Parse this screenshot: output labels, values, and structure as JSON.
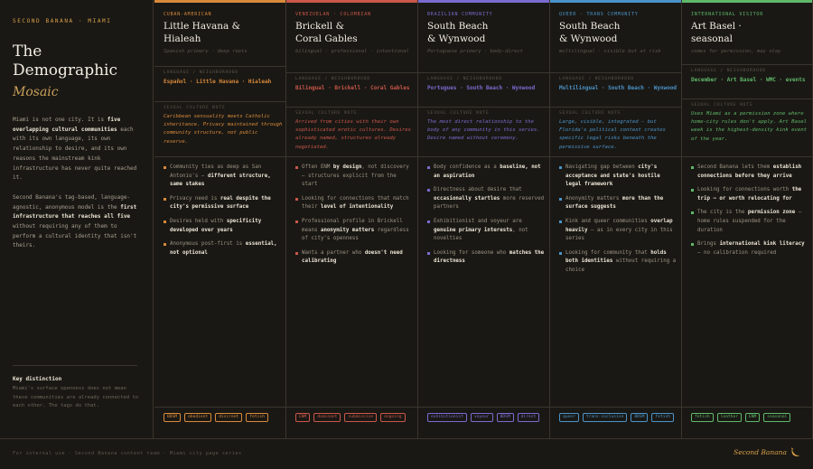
{
  "brand": "SECOND BANANA · MIAMI",
  "hero": {
    "line1": "The",
    "line2": "Demographic",
    "line3": "Mosaic"
  },
  "intro": {
    "p1_a": "Miami is not one city. It is ",
    "p1_b": "five overlapping cultural communities",
    "p1_c": " each with its own language, its own relationship to desire, and its own reasons the mainstream kink infrastructure has never quite reached it.",
    "p2_a": "Second Banana's tag-based, language-agnostic, anonymous model is the ",
    "p2_b": "first infrastructure that reaches all five",
    "p2_c": " without requiring any of them to perform a cultural identity that isn't theirs."
  },
  "key_distinction": {
    "title": "Key distinction",
    "body": "Miami's surface openness does not mean these communities are already connected to each other. The tags do that."
  },
  "labels": {
    "lang": "LANGUAGE / NEIGHBORHOOD",
    "ctx": "SEXUAL CULTURE NOTE"
  },
  "columns": [
    {
      "tag": "CUBAN-AMERICAN",
      "title_1": "Little Havana &",
      "title_2": "Hialeah",
      "sub": "Spanish primary · deep roots",
      "lang": "Español · Little Havana · Hialeah",
      "ctx": "Caribbean sensuality meets Catholic inheritance. Privacy maintained through community structure, not public reserve.",
      "bullets": [
        {
          "a": "Community ties as deep as San Antonio's — ",
          "b": "different structure, same stakes",
          "c": ""
        },
        {
          "a": "Privacy need is ",
          "b": "real despite the city's permissive surface",
          "c": ""
        },
        {
          "a": "Desires held with ",
          "b": "specificity developed over years",
          "c": ""
        },
        {
          "a": "Anonymous post-first is ",
          "b": "essential, not optional",
          "c": ""
        }
      ],
      "tags": [
        "BDSM",
        "obedient",
        "discreet",
        "fetish"
      ]
    },
    {
      "tag": "VENEZUELAN · COLOMBIAN",
      "title_1": "Brickell &",
      "title_2": "Coral Gables",
      "sub": "bilingual · professional · intentional",
      "lang": "Bilingual · Brickell · Coral Gables",
      "ctx": "Arrived from cities with their own sophisticated erotic cultures. Desires already named, structures already negotiated.",
      "bullets": [
        {
          "a": "Often ENM ",
          "b": "by design",
          "c": ", not discovery — structures explicit from the start"
        },
        {
          "a": "Looking for connections that match their ",
          "b": "level of intentionality",
          "c": ""
        },
        {
          "a": "Professional profile in Brickell means ",
          "b": "anonymity matters",
          "c": " regardless of city's openness"
        },
        {
          "a": "Wants a partner who ",
          "b": "doesn't need calibrating",
          "c": ""
        }
      ],
      "tags": [
        "ENM",
        "dominant",
        "submissive",
        "ongoing"
      ]
    },
    {
      "tag": "BRAZILIAN COMMUNITY",
      "title_1": "South Beach",
      "title_2": "& Wynwood",
      "sub": "Portuguese primary · body-direct",
      "lang": "Portugues · South Beach · Wynwood",
      "ctx": "The most direct relationship to the body of any community in this series. Desire named without ceremony.",
      "bullets": [
        {
          "a": "Body confidence as a ",
          "b": "baseline, not an aspiration",
          "c": ""
        },
        {
          "a": "Directness about desire that ",
          "b": "occasionally startles",
          "c": " more reserved partners"
        },
        {
          "a": "Exhibitionist and voyeur are ",
          "b": "genuine primary interests",
          "c": ", not novelties"
        },
        {
          "a": "Looking for someone who ",
          "b": "matches the directness",
          "c": ""
        }
      ],
      "tags": [
        "exhibitionist",
        "voyeur",
        "BDSM",
        "direct"
      ]
    },
    {
      "tag": "QUEER · TRANS COMMUNITY",
      "title_1": "South Beach",
      "title_2": "& Wynwood",
      "sub": "multilingual · visible but at risk",
      "lang": "Multilingual · South Beach · Wynwood",
      "ctx": "Large, visible, integrated — but Florida's political context creates specific legal risks beneath the permissive surface.",
      "bullets": [
        {
          "a": "Navigating gap between ",
          "b": "city's acceptance and state's hostile legal framework",
          "c": ""
        },
        {
          "a": "Anonymity matters ",
          "b": "more than the surface suggests",
          "c": ""
        },
        {
          "a": "Kink and queer communities ",
          "b": "overlap heavily",
          "c": " — as in every city in this series"
        },
        {
          "a": "Looking for community that ",
          "b": "holds both identities",
          "c": " without requiring a choice"
        }
      ],
      "tags": [
        "queer",
        "trans-inclusive",
        "BDSM",
        "fetish"
      ]
    },
    {
      "tag": "INTERNATIONAL VISITOR",
      "title_1": "Art Basel ·",
      "title_2": "seasonal",
      "sub": "comes for permission, may stay",
      "lang": "December · Art Basel · WMC · events",
      "ctx": "Uses Miami as a permission zone where home-city rules don't apply. Art Basel week is the highest-density kink event of the year.",
      "bullets": [
        {
          "a": "Second Banana lets them ",
          "b": "establish connections before they arrive",
          "c": ""
        },
        {
          "a": "Looking for connections worth ",
          "b": "the trip — or worth relocating for",
          "c": ""
        },
        {
          "a": "The city is the ",
          "b": "permission zone",
          "c": " — home rules suspended for the duration"
        },
        {
          "a": "Brings ",
          "b": "international kink literacy",
          "c": " — no calibration required"
        }
      ],
      "tags": [
        "fetish",
        "leather",
        "ENM",
        "seasonal"
      ]
    }
  ],
  "colors": {
    "col1": "#d88a3c",
    "col2": "#c9574a",
    "col3": "#7a6bd0",
    "col4": "#4a93c9",
    "col5": "#5fb86a"
  },
  "footer": {
    "note": "For internal use · Second Banana content team · Miami city page series",
    "logo": "Second Banana"
  }
}
